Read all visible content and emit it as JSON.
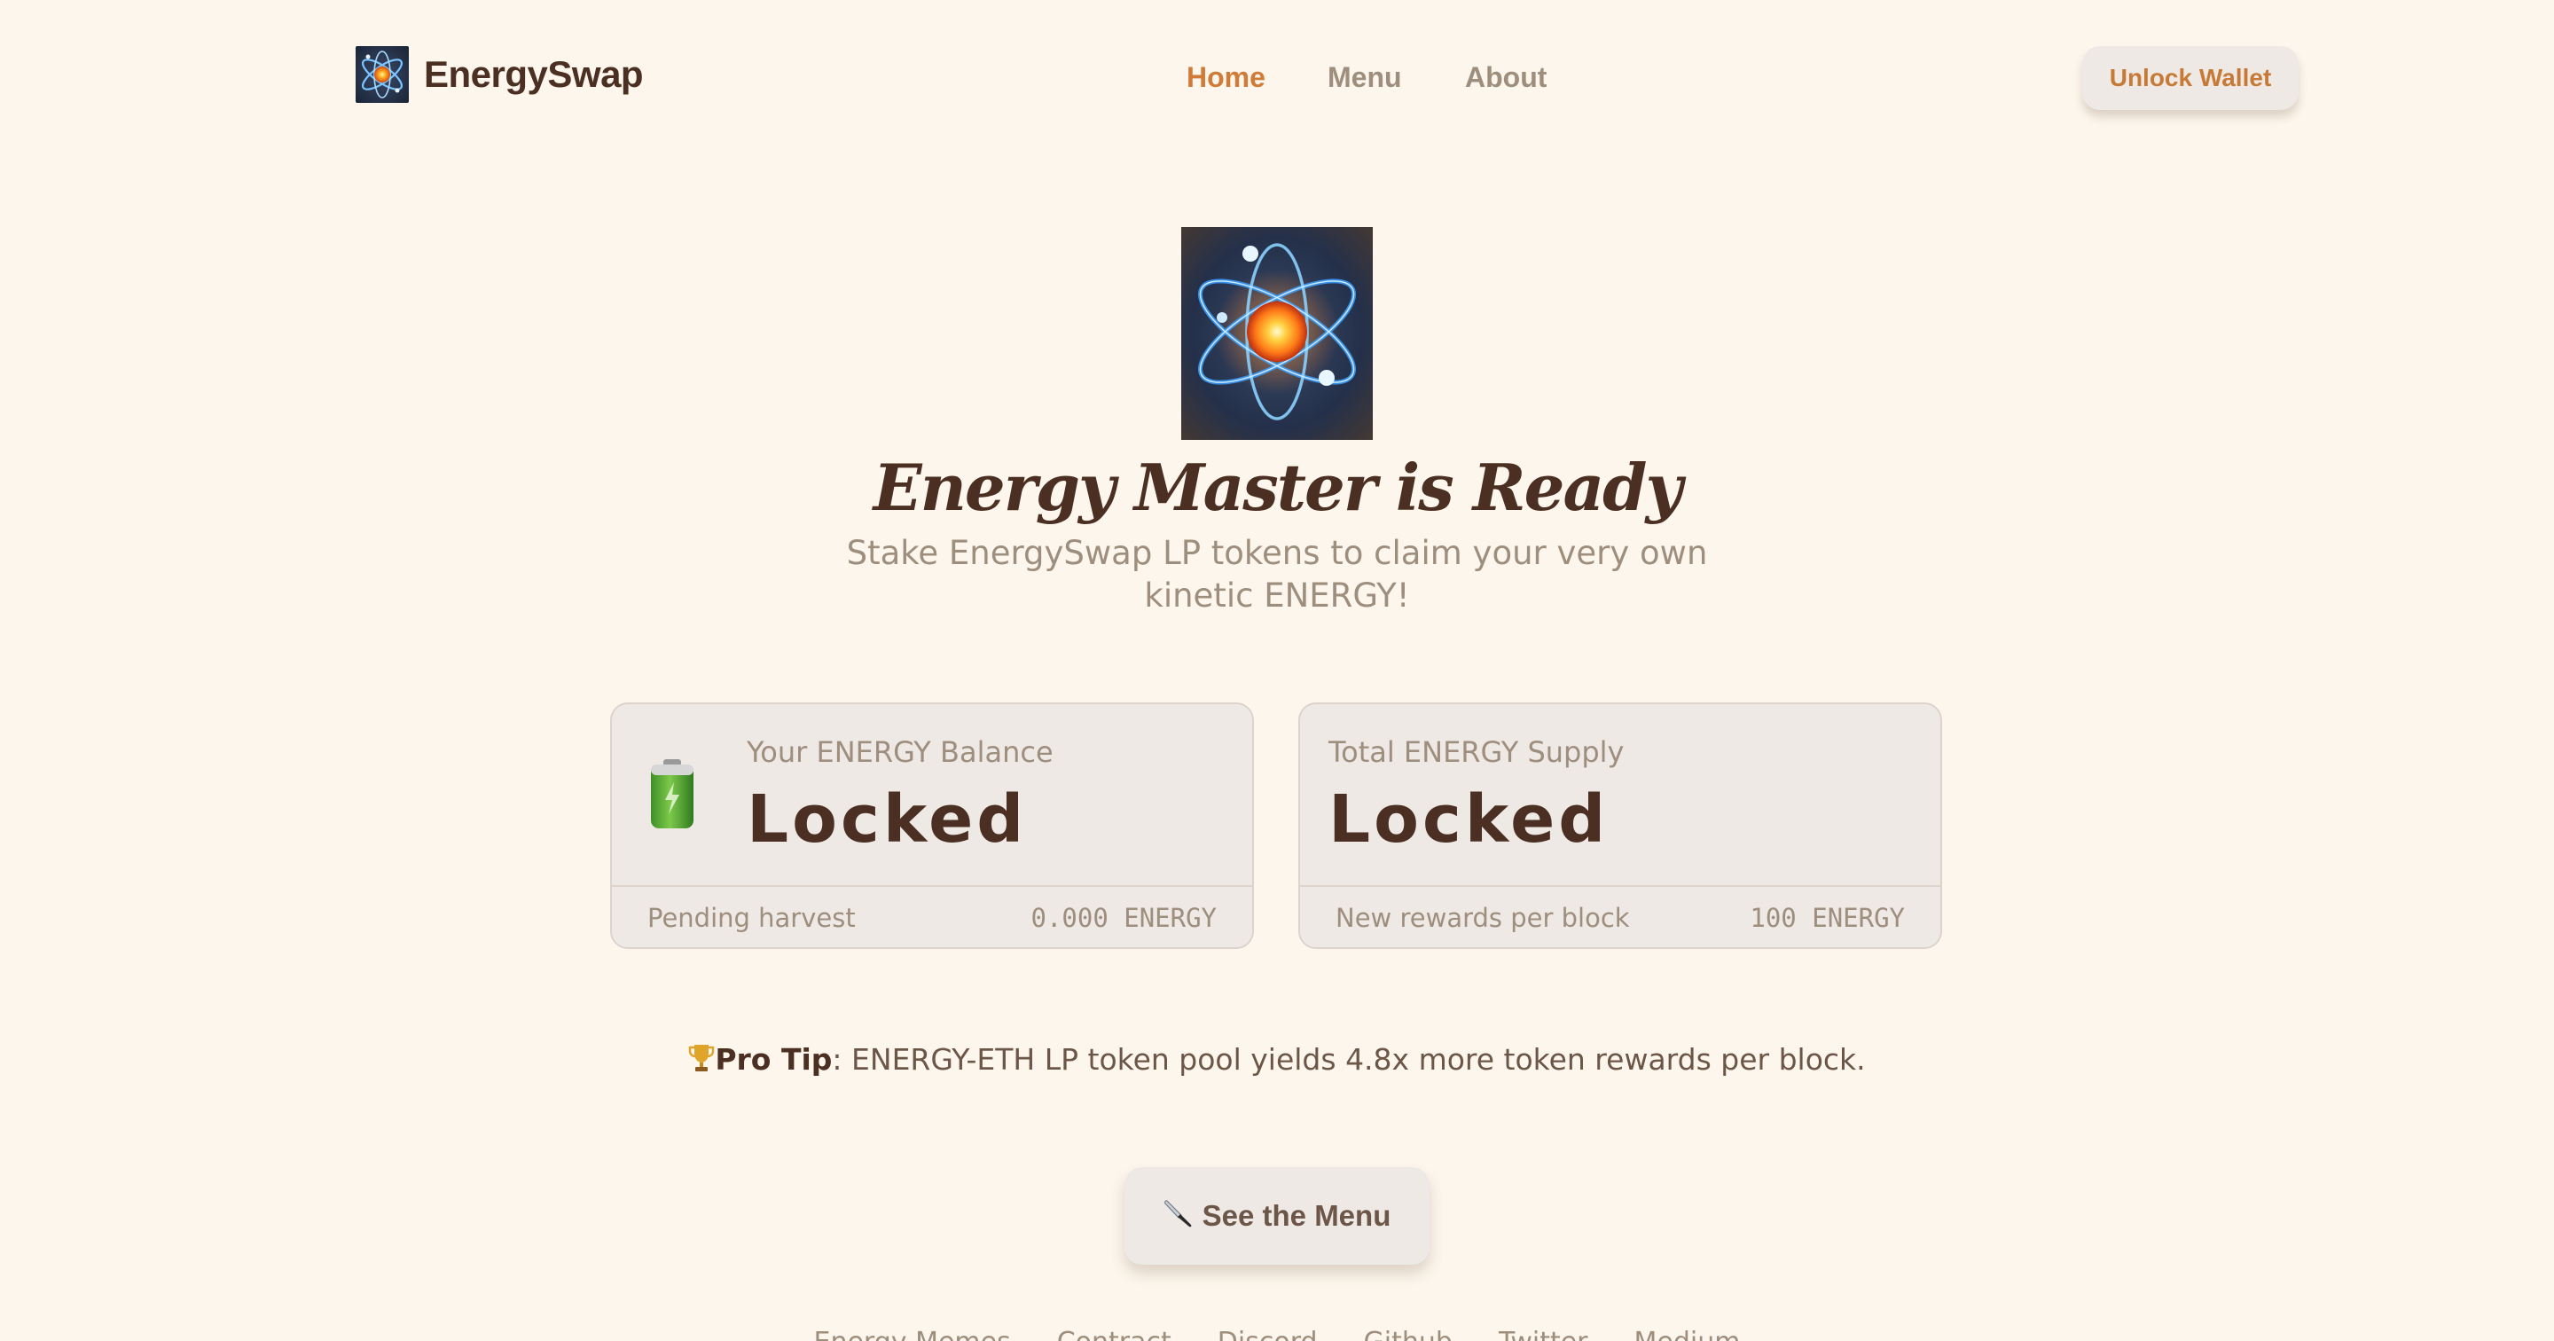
{
  "header": {
    "logo_text": "EnergySwap",
    "nav": [
      {
        "label": "Home",
        "active": true
      },
      {
        "label": "Menu",
        "active": false
      },
      {
        "label": "About",
        "active": false
      }
    ],
    "unlock_wallet_label": "Unlock Wallet"
  },
  "hero": {
    "title": "Energy Master is Ready",
    "subtitle": "Stake EnergySwap LP tokens to claim your very own kinetic ENERGY!"
  },
  "cards": {
    "balance": {
      "icon": "battery-icon",
      "label": "Your ENERGY Balance",
      "value": "Locked",
      "footer_label": "Pending harvest",
      "footer_value": "0.000 ENERGY"
    },
    "supply": {
      "label": "Total ENERGY Supply",
      "value": "Locked",
      "footer_label": "New rewards per block",
      "footer_value": "100 ENERGY"
    }
  },
  "pro_tip": {
    "icon": "trophy-icon",
    "title": "Pro Tip",
    "text": ": ENERGY-ETH LP token pool yields 4.8x more token rewards per block."
  },
  "see_menu": {
    "icon": "knife-icon",
    "label": "See the Menu"
  },
  "footer": {
    "links": [
      "Energy Memes",
      "Contract",
      "Discord",
      "Github",
      "Twitter",
      "Medium"
    ]
  },
  "colors": {
    "background": "#fdf6ec",
    "brand_dark": "#4a2f22",
    "accent": "#d07b38",
    "muted": "#9e8e7d",
    "card": "#efe9e6"
  }
}
